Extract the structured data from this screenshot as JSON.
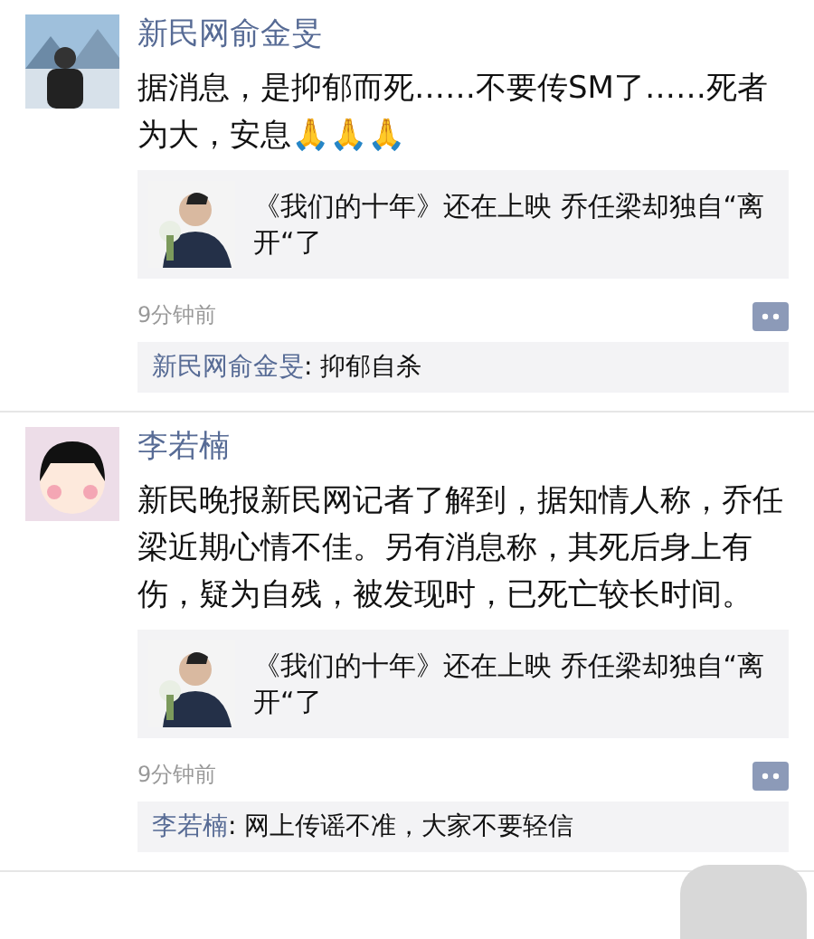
{
  "posts": [
    {
      "author": "新民网俞金旻",
      "avatar": {
        "kind": "picture"
      },
      "text": "据消息，是抑郁而死……不要传SM了……死者为大，安息🙏🙏🙏",
      "link": {
        "title": "《我们的十年》还在上映 乔任梁却独自“离开“了"
      },
      "time": "9分钟前",
      "comments": [
        {
          "author": "新民网俞金旻",
          "text": ": 抑郁自杀"
        }
      ]
    },
    {
      "author": "李若楠",
      "avatar": {
        "kind": "cartoon"
      },
      "text": "新民晚报新民网记者了解到，据知情人称，乔任梁近期心情不佳。另有消息称，其死后身上有伤，疑为自残，被发现时，已死亡较长时间。",
      "link": {
        "title": "《我们的十年》还在上映 乔任梁却独自“离开“了"
      },
      "time": "9分钟前",
      "comments": [
        {
          "author": "李若楠",
          "text": ": 网上传谣不准，大家不要轻信"
        }
      ]
    }
  ]
}
